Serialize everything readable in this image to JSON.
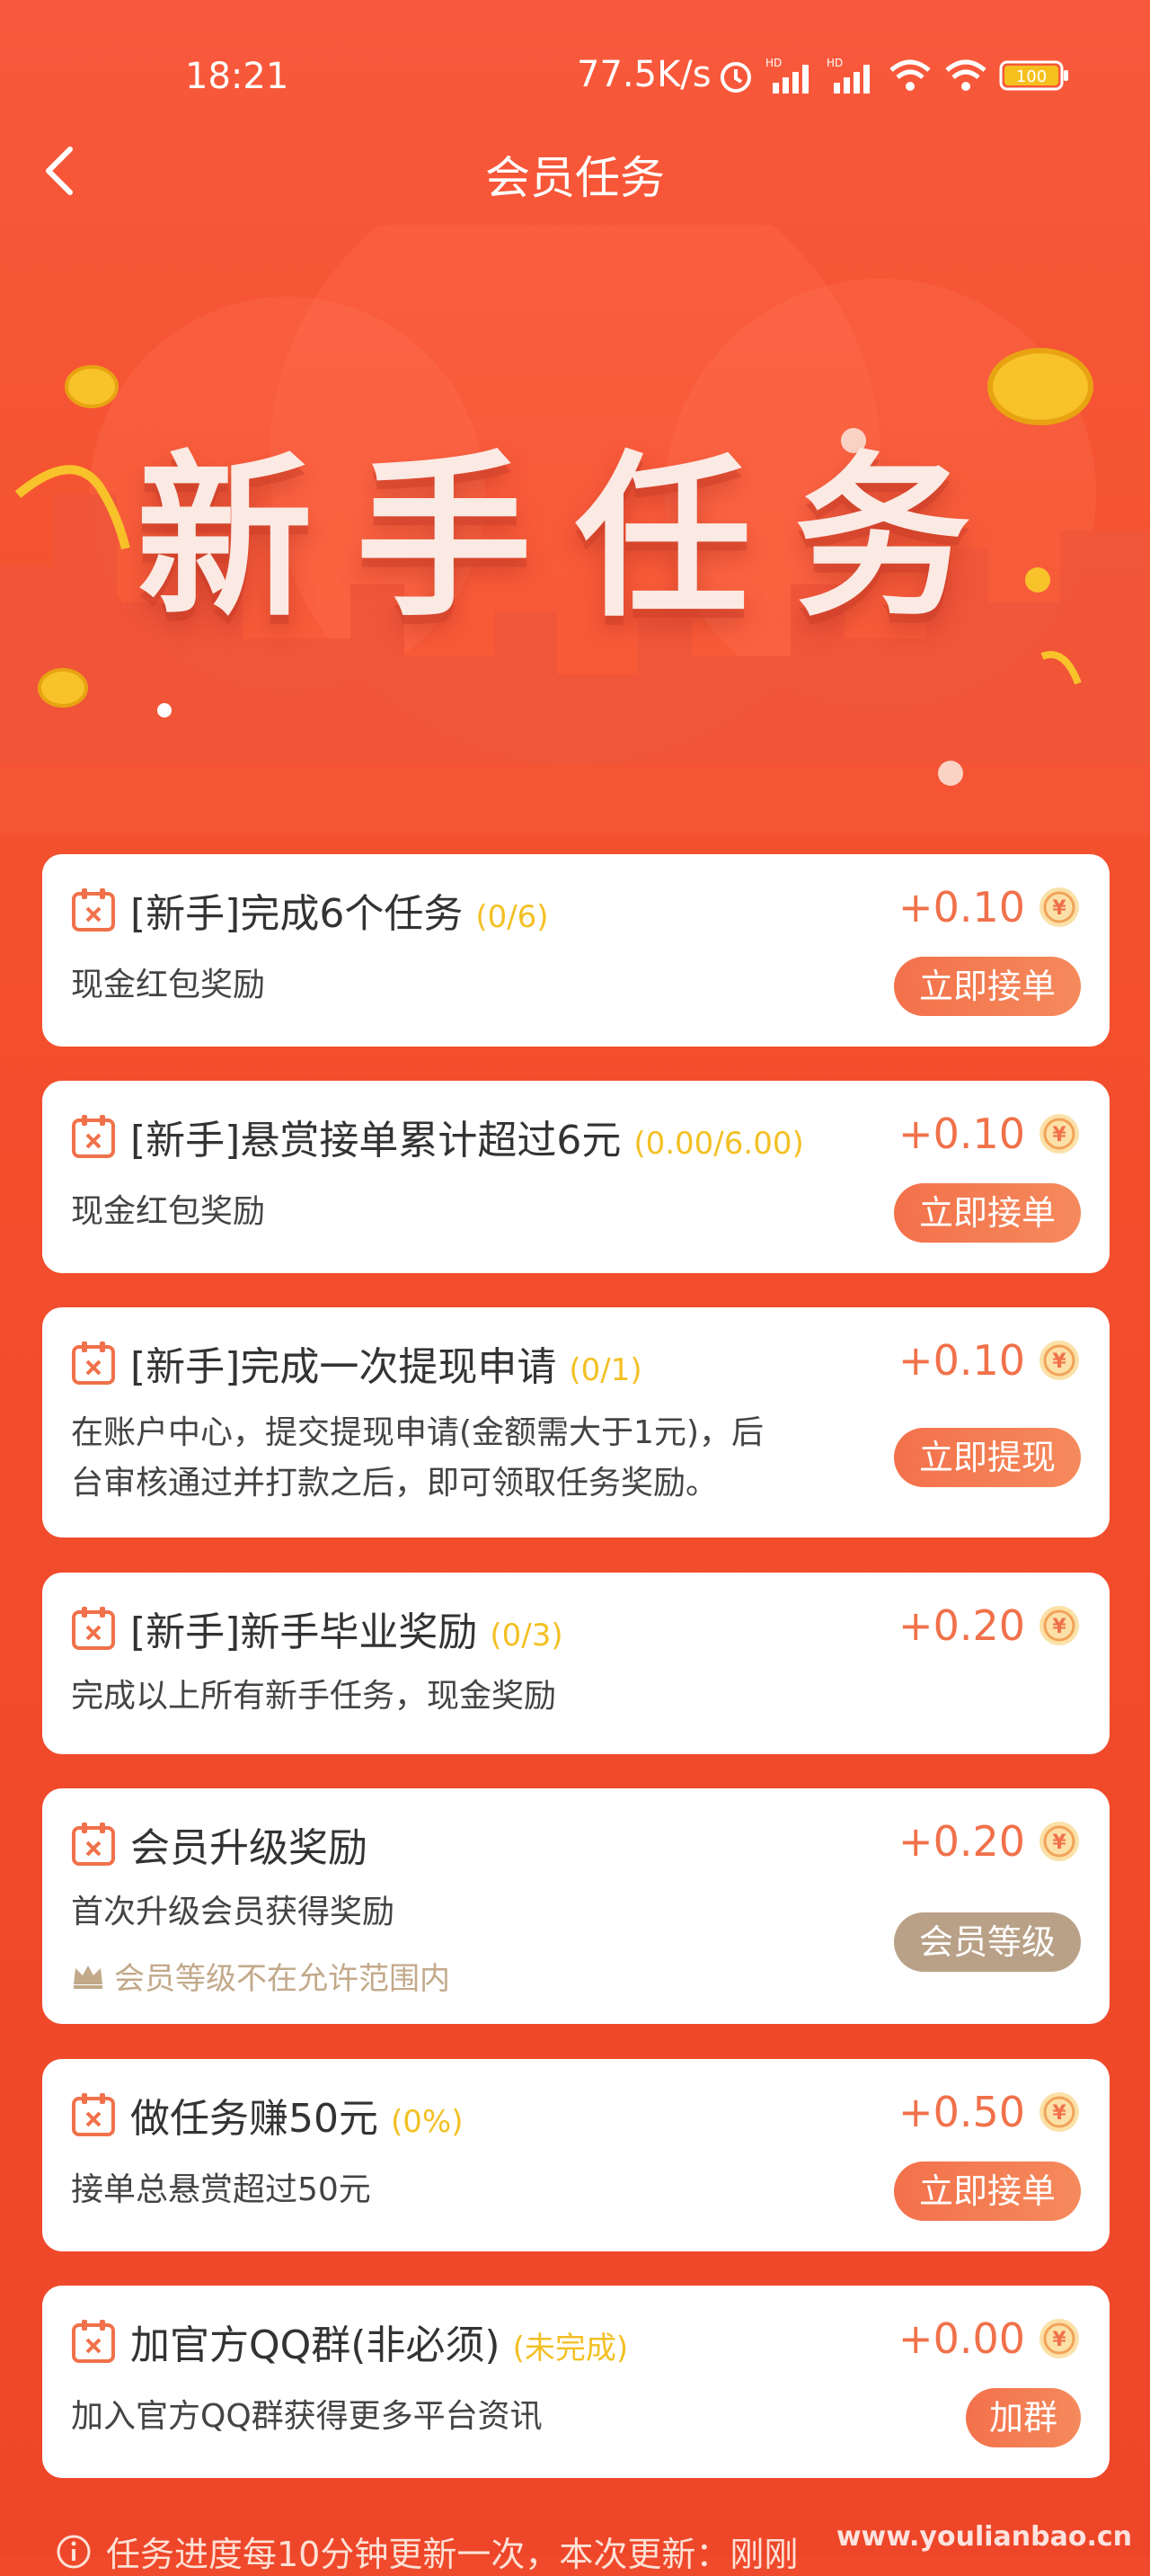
{
  "status_bar": {
    "time": "18:21",
    "network_speed": "77.5K/s",
    "battery": "100"
  },
  "header": {
    "title": "会员任务"
  },
  "banner": {
    "title": "新手任务"
  },
  "tasks": [
    {
      "title": "[新手]完成6个任务",
      "progress": "(0/6)",
      "reward": "+0.10",
      "desc": "现金红包奖励",
      "button": "立即接单"
    },
    {
      "title": "[新手]悬赏接单累计超过6元",
      "progress": "(0.00/6.00)",
      "reward": "+0.10",
      "desc": "现金红包奖励",
      "button": "立即接单"
    },
    {
      "title": "[新手]完成一次提现申请",
      "progress": "(0/1)",
      "reward": "+0.10",
      "desc_line1": "在账户中心，提交提现申请(金额需大于1元)，后",
      "desc_line2": "台审核通过并打款之后，即可领取任务奖励。",
      "button": "立即提现"
    },
    {
      "title": "[新手]新手毕业奖励",
      "progress": "(0/3)",
      "reward": "+0.20",
      "desc": "完成以上所有新手任务，现金奖励"
    },
    {
      "title": "会员升级奖励",
      "reward": "+0.20",
      "desc": "首次升级会员获得奖励",
      "warning": "会员等级不在允许范围内",
      "button": "会员等级"
    },
    {
      "title": "做任务赚50元",
      "progress": "(0%)",
      "reward": "+0.50",
      "desc": "接单总悬赏超过50元",
      "button": "立即接单"
    },
    {
      "title": "加官方QQ群(非必须)",
      "progress": "(未完成)",
      "reward": "+0.00",
      "desc": "加入官方QQ群获得更多平台资讯",
      "button": "加群"
    }
  ],
  "footer_note": "任务进度每10分钟更新一次，本次更新：刚刚",
  "watermark": "www.youlianbao.cn",
  "colors": {
    "primary": "#f24d2c",
    "reward": "#f0714a",
    "progress": "#f3c024",
    "tan_button": "#b9a187"
  }
}
